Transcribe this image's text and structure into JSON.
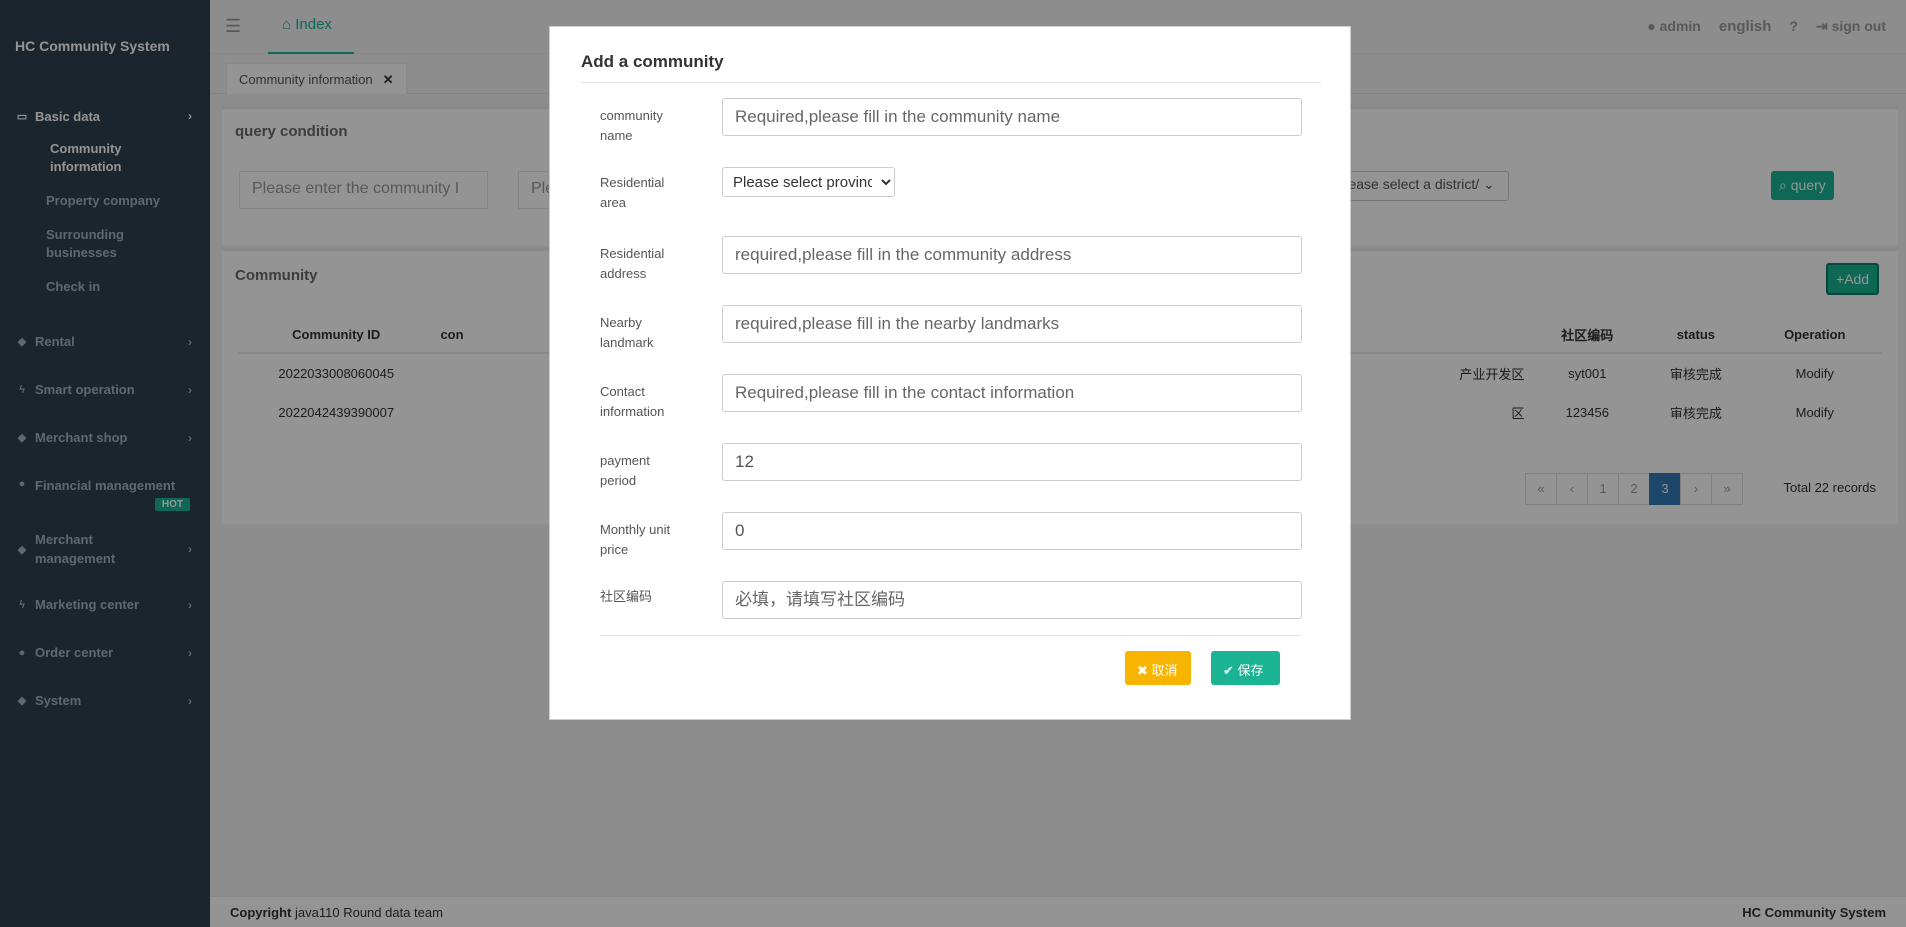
{
  "app": {
    "brand": "HC Community System"
  },
  "sidebar": {
    "items": [
      {
        "label": "Basic data",
        "icon": "laptop-icon"
      },
      {
        "label": "Rental",
        "icon": "diamond-icon"
      },
      {
        "label": "Smart operation",
        "icon": "bolt-icon"
      },
      {
        "label": "Merchant shop",
        "icon": "diamond-icon"
      },
      {
        "label": "Financial management",
        "icon": "globe-icon",
        "badge": "HOT"
      },
      {
        "label": "Merchant management",
        "icon": "diamond-icon"
      },
      {
        "label": "Marketing center",
        "icon": "bolt-icon"
      },
      {
        "label": "Order center",
        "icon": "globe-icon"
      },
      {
        "label": "System",
        "icon": "diamond-icon"
      }
    ],
    "sub_items": [
      "Community information",
      "Property company",
      "Surrounding businesses",
      "Check in"
    ]
  },
  "topbar": {
    "tab_index": "Index",
    "user": "admin",
    "language": "english",
    "signout": "sign out"
  },
  "tabbar": {
    "tab": "Community information"
  },
  "query": {
    "title": "query condition",
    "name_placeholder": "Please enter the community I",
    "second_placeholder": "Ple",
    "district_select": "Please select a district/",
    "button": "query"
  },
  "community": {
    "title": "Community",
    "add_button": "Add",
    "columns": [
      "Community ID",
      "con",
      "社区编码",
      "status",
      "Operation"
    ],
    "rows": [
      {
        "id": "2022033008060045",
        "area": "产业开发区",
        "code": "syt001",
        "status": "审核完成",
        "op": "Modify"
      },
      {
        "id": "2022042439390007",
        "area": "区",
        "code": "123456",
        "status": "审核完成",
        "op": "Modify"
      }
    ],
    "pager": [
      "«",
      "‹",
      "1",
      "2",
      "3",
      "›",
      "»"
    ],
    "total": "Total 22 records"
  },
  "footer": {
    "copyright_label": "Copyright",
    "team": "java110 Round data team",
    "brand": "HC Community System"
  },
  "modal": {
    "title": "Add a community",
    "fields": [
      {
        "label": "community name",
        "placeholder": "Required,please fill in the community name",
        "value": ""
      },
      {
        "label": "Residential area",
        "select": "Please select province"
      },
      {
        "label": "Residential address",
        "placeholder": "required,please fill in the community address",
        "value": ""
      },
      {
        "label": "Nearby landmark",
        "placeholder": "required,please fill in the nearby landmarks",
        "value": ""
      },
      {
        "label": "Contact information",
        "placeholder": "Required,please fill in the contact information",
        "value": ""
      },
      {
        "label": "payment period",
        "placeholder": "",
        "value": "12"
      },
      {
        "label": "Monthly unit price",
        "placeholder": "",
        "value": "0"
      },
      {
        "label": "社区编码",
        "placeholder": "必填，请填写社区编码",
        "value": ""
      }
    ],
    "cancel": "取消",
    "save": "保存"
  }
}
